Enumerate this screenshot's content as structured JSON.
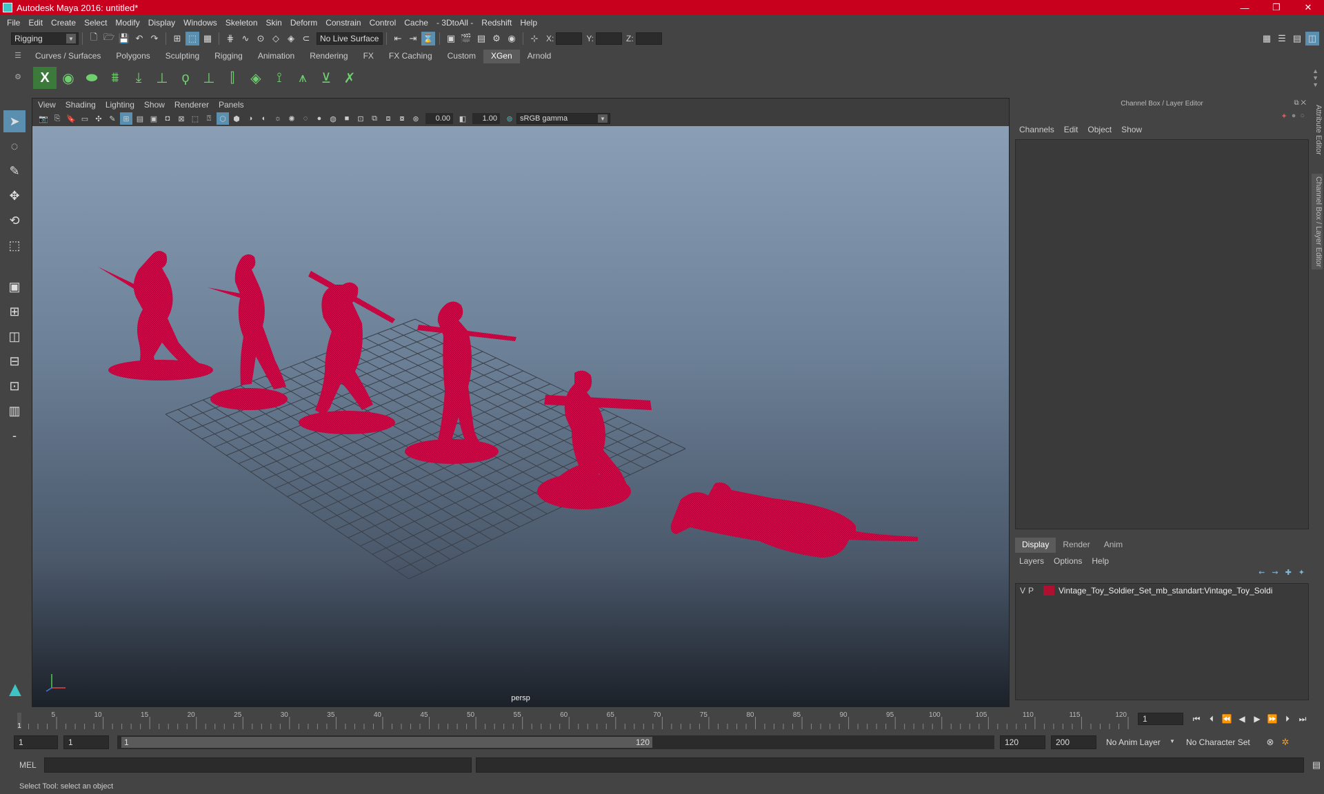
{
  "window": {
    "title": "Autodesk Maya 2016: untitled*",
    "controls": [
      "—",
      "❐",
      "✕"
    ]
  },
  "menus": [
    "File",
    "Edit",
    "Create",
    "Select",
    "Modify",
    "Display",
    "Windows",
    "Skeleton",
    "Skin",
    "Deform",
    "Constrain",
    "Control",
    "Cache",
    "- 3DtoAll -",
    "Redshift",
    "Help"
  ],
  "statusline": {
    "menu_set": "Rigging",
    "live_surface": "No Live Surface",
    "x_label": "X:",
    "y_label": "Y:",
    "z_label": "Z:"
  },
  "shelf": {
    "tabs": [
      "Curves / Surfaces",
      "Polygons",
      "Sculpting",
      "Rigging",
      "Animation",
      "Rendering",
      "FX",
      "FX Caching",
      "Custom",
      "XGen",
      "Arnold"
    ],
    "active_tab": "XGen"
  },
  "viewport": {
    "menus": [
      "View",
      "Shading",
      "Lighting",
      "Show",
      "Renderer",
      "Panels"
    ],
    "exposure": "0.00",
    "gamma": "1.00",
    "color_space": "sRGB gamma",
    "camera_label": "persp",
    "mesh_color": "#c8003c"
  },
  "channel_box": {
    "header": "Channel Box / Layer Editor",
    "menus": [
      "Channels",
      "Edit",
      "Object",
      "Show"
    ],
    "layer_tabs": [
      "Display",
      "Render",
      "Anim"
    ],
    "active_layer_tab": "Display",
    "layer_menus": [
      "Layers",
      "Options",
      "Help"
    ],
    "layer": {
      "v": "V",
      "p": "P",
      "name": "Vintage_Toy_Soldier_Set_mb_standart:Vintage_Toy_Soldi",
      "color": "#b01030"
    }
  },
  "side_tabs": [
    "Attribute Editor",
    "Channel Box / Layer Editor"
  ],
  "timeline": {
    "ticks": [
      "5",
      "10",
      "15",
      "20",
      "25",
      "30",
      "35",
      "40",
      "45",
      "50",
      "55",
      "60",
      "65",
      "70",
      "75",
      "80",
      "85",
      "90",
      "95",
      "100",
      "105",
      "110",
      "115",
      "120"
    ],
    "current_marker": "1",
    "current_frame": "1"
  },
  "range": {
    "start": "1",
    "playback_start": "1",
    "slider_start": "1",
    "slider_end": "120",
    "playback_end": "120",
    "end": "200",
    "anim_layer": "No Anim Layer",
    "character_set": "No Character Set"
  },
  "command": {
    "language": "MEL"
  },
  "help_line": "Select Tool: select an object"
}
